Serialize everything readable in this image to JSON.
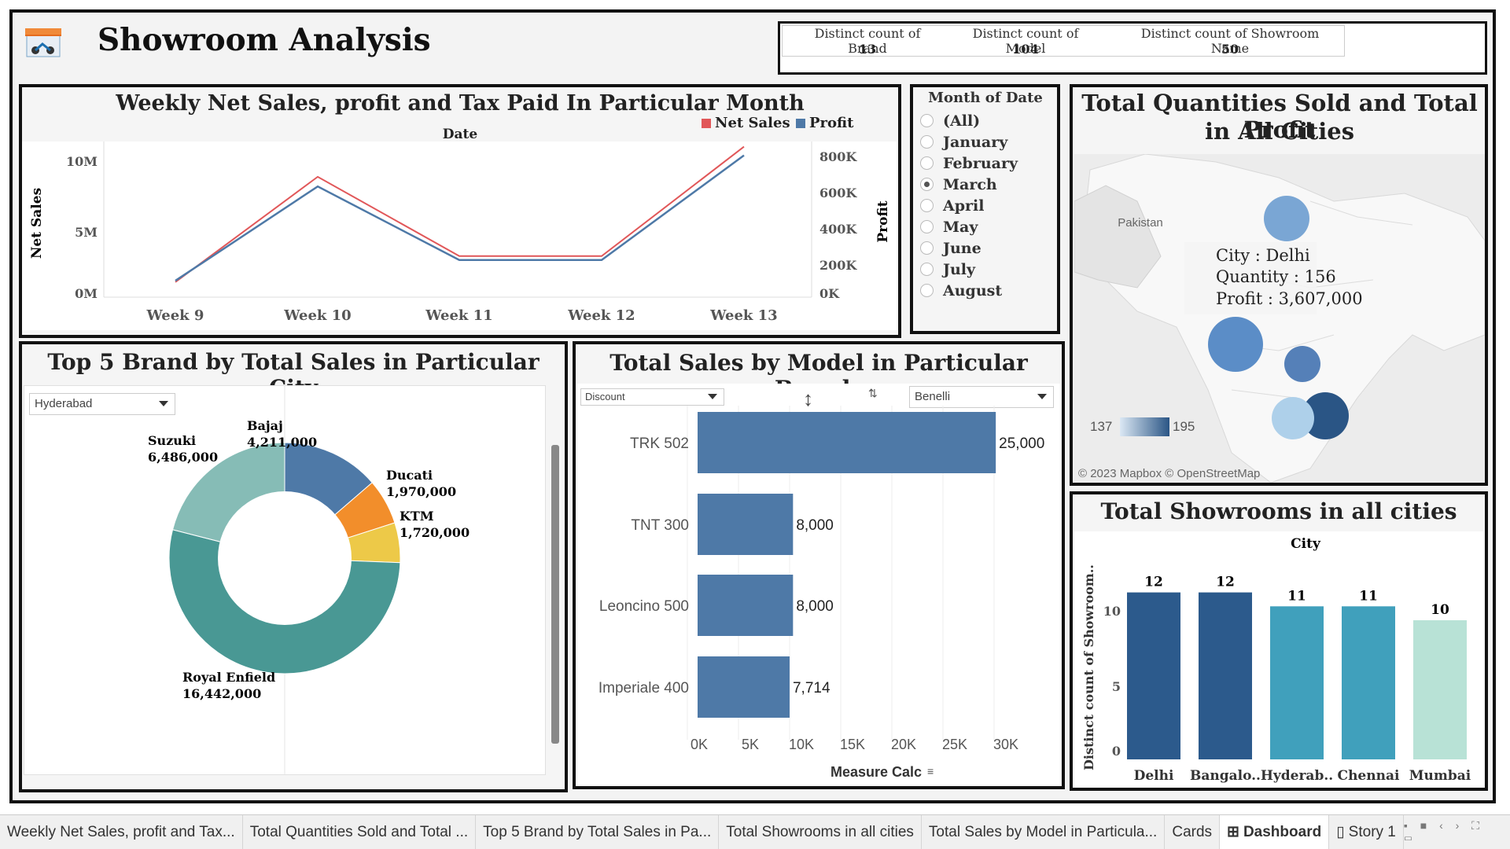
{
  "header": {
    "title": "Showroom Analysis"
  },
  "kpis": [
    {
      "label": "Distinct count of Brand",
      "value": "13"
    },
    {
      "label": "Distinct count of Model",
      "value": "104"
    },
    {
      "label": "Distinct count of Showroom Name",
      "value": "50"
    }
  ],
  "weekly": {
    "title": "Weekly Net Sales, profit and Tax Paid In Particular Month",
    "legend": [
      "Net Sales",
      "Profit"
    ],
    "colors": {
      "net_sales": "#e15759",
      "profit": "#4e79a7"
    },
    "date_label": "Date",
    "ylabel_left": "Net Sales",
    "ylabel_right": "Profit",
    "left_ticks": [
      "10M",
      "5M",
      "0M"
    ],
    "right_ticks": [
      "800K",
      "600K",
      "400K",
      "200K",
      "0K"
    ],
    "week_labels": [
      "Week 9",
      "Week 10",
      "Week 11",
      "Week 12",
      "Week 13"
    ]
  },
  "month_filter": {
    "title": "Month of Date",
    "options": [
      "(All)",
      "January",
      "February",
      "March",
      "April",
      "May",
      "June",
      "July",
      "August"
    ],
    "selected": "March"
  },
  "map": {
    "title_line1": "Total Quantities Sold and Total Profit",
    "title_line2": "in All Cities",
    "country_label": "Pakistan",
    "tooltip_city": "City : Delhi",
    "tooltip_quantity": "Quantity : 156",
    "tooltip_profit": "Profit : 3,607,000",
    "legend_min": "137",
    "legend_max": "195",
    "attribution": "© 2023 Mapbox © OpenStreetMap"
  },
  "donut": {
    "title": "Top 5 Brand by Total Sales in Particular City",
    "city_filter": "Hyderabad",
    "labels": [
      {
        "name": "Bajaj",
        "value": "4,211,000"
      },
      {
        "name": "Ducati",
        "value": "1,970,000"
      },
      {
        "name": "KTM",
        "value": "1,720,000"
      },
      {
        "name": "Royal Enfield",
        "value": "16,442,000"
      },
      {
        "name": "Suzuki",
        "value": "6,486,000"
      }
    ]
  },
  "models": {
    "title": "Total Sales by Model in Particular Brands",
    "measure_filter": "Discount",
    "brand_filter": "Benelli",
    "xlabel": "Measure Calc",
    "value_labels": [
      "25,000",
      "8,000",
      "8,000",
      "7,714"
    ],
    "x_ticks": [
      "0K",
      "5K",
      "10K",
      "15K",
      "20K",
      "25K",
      "30K"
    ]
  },
  "showrooms": {
    "title": "Total Showrooms in all cities",
    "header_label": "City",
    "ylabel": "Distinct count of Showroom..",
    "y_ticks": [
      "10",
      "5",
      "0"
    ],
    "value_labels": [
      "12",
      "12",
      "11",
      "11",
      "10"
    ],
    "city_labels": [
      "Delhi",
      "Bangalo..",
      "Hyderab..",
      "Chennai",
      "Mumbai"
    ]
  },
  "chart_data": [
    {
      "type": "line",
      "title": "Weekly Net Sales, profit and Tax Paid In Particular Month",
      "xlabel": "Date",
      "ylabel": "Net Sales",
      "x": [
        "Week 9",
        "Week 10",
        "Week 11",
        "Week 12",
        "Week 13"
      ],
      "series": [
        {
          "name": "Net Sales",
          "values": [
            1.1,
            8.8,
            3.0,
            3.0,
            11.0
          ]
        },
        {
          "name": "Profit",
          "values": [
            95000,
            640000,
            215000,
            215000,
            820000
          ]
        }
      ],
      "ylim_left": [
        0,
        10
      ],
      "ylim_right": [
        0,
        800000
      ],
      "units_left": "M"
    },
    {
      "type": "pie",
      "title": "Top 5 Brand by Total Sales in Particular City",
      "categories": [
        "Bajaj",
        "Ducati",
        "KTM",
        "Royal Enfield",
        "Suzuki"
      ],
      "values": [
        4211000,
        1970000,
        1720000,
        16442000,
        6486000
      ],
      "colors": [
        "#4e79a7",
        "#f28e2b",
        "#edc948",
        "#499894",
        "#86bcb6"
      ]
    },
    {
      "type": "bar",
      "title": "Total Sales by Model in Particular Brands",
      "categories": [
        "TRK 502",
        "TNT 300",
        "Leoncino 500",
        "Imperiale 400"
      ],
      "values": [
        25000,
        8000,
        8000,
        7714
      ],
      "xlabel": "Measure Calc",
      "xlim": [
        0,
        30000
      ],
      "color": "#4e79a7"
    },
    {
      "type": "bar",
      "title": "Total Showrooms in all cities",
      "categories": [
        "Delhi",
        "Bangalo..",
        "Hyderab..",
        "Chennai",
        "Mumbai"
      ],
      "values": [
        12,
        12,
        11,
        11,
        10
      ],
      "ylabel": "Distinct count of Showroom..",
      "ylim": [
        0,
        12
      ],
      "colors": [
        "#2c5a8c",
        "#2c5a8c",
        "#40a0bc",
        "#40a0bc",
        "#b8e2d6"
      ]
    }
  ],
  "tabs": [
    "Weekly Net Sales, profit and Tax...",
    "Total Quantities Sold and Total ...",
    "Top 5 Brand by Total Sales in Pa...",
    "Total Showrooms in all cities",
    "Total Sales by Model in Particula...",
    "Cards",
    "Dashboard",
    "Story 1"
  ],
  "tab_icons": {
    "dashboard": "dashboard-grid-icon",
    "story": "story-book-icon"
  }
}
